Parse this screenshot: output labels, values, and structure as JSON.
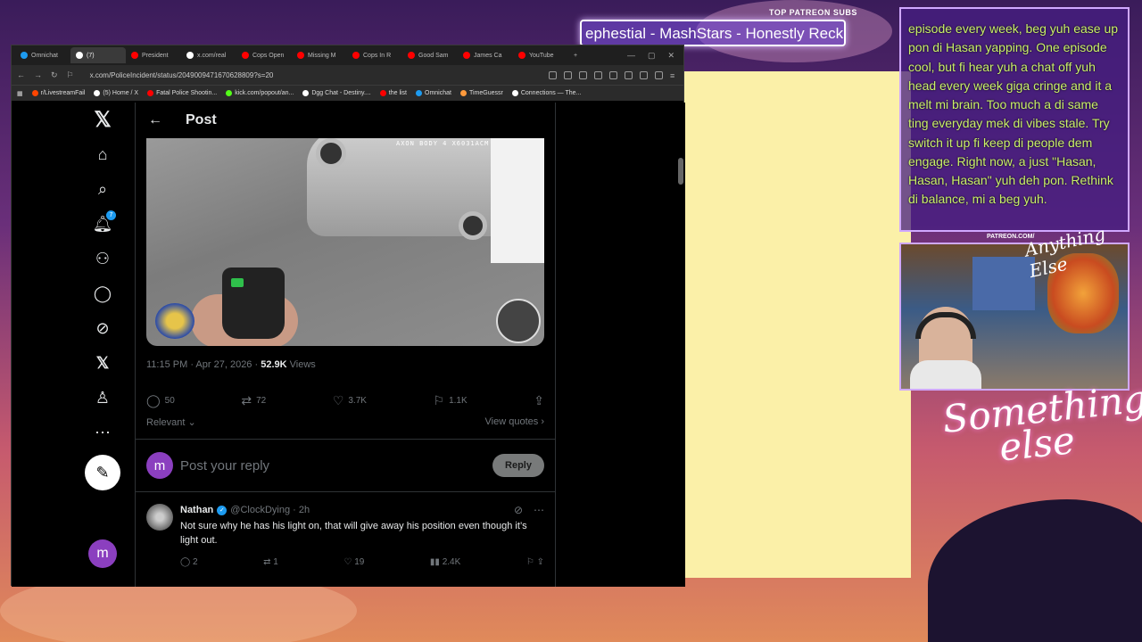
{
  "browser": {
    "tabs": [
      {
        "label": "Omnichat",
        "color": "#1d9bf0",
        "active": false
      },
      {
        "label": "(7)",
        "color": "#ffffff",
        "active": true
      },
      {
        "label": "President",
        "color": "#ff0000",
        "active": false
      },
      {
        "label": "x.com/real",
        "color": "#ffffff",
        "active": false
      },
      {
        "label": "Cops Open",
        "color": "#ff0000",
        "active": false
      },
      {
        "label": "Missing M",
        "color": "#ff0000",
        "active": false
      },
      {
        "label": "Cops In R",
        "color": "#ff0000",
        "active": false
      },
      {
        "label": "Good Sam",
        "color": "#ff0000",
        "active": false
      },
      {
        "label": "James Ca",
        "color": "#ff0000",
        "active": false
      },
      {
        "label": "YouTube",
        "color": "#ff0000",
        "active": false
      }
    ],
    "new_tab": "+",
    "url": "x.com/PoliceIncident/status/2049009471670628809?s=20",
    "bookmarks": [
      {
        "label": "r/LivestreamFail",
        "color": "#ff4500"
      },
      {
        "label": "(5) Home / X",
        "color": "#ffffff"
      },
      {
        "label": "Fatal Police Shootin...",
        "color": "#ff0000"
      },
      {
        "label": "kick.com/popout/an...",
        "color": "#53fc18"
      },
      {
        "label": "Dgg Chat - Destiny....",
        "color": "#ffffff"
      },
      {
        "label": "the list",
        "color": "#ff0000"
      },
      {
        "label": "Omnichat",
        "color": "#1d9bf0"
      },
      {
        "label": "TimeGuessr",
        "color": "#ff9a3c"
      },
      {
        "label": "Connections — The...",
        "color": "#ffffff"
      }
    ]
  },
  "x": {
    "nav": {
      "notifications_badge": "7",
      "avatar_letter": "m"
    },
    "header": {
      "back": "←",
      "title": "Post"
    },
    "video": {
      "stamp": "AXON BODY 4 X6031ACM"
    },
    "meta": {
      "time": "11:15 PM · Apr 27, 2026 · ",
      "views_count": "52.9K",
      "views_label": " Views"
    },
    "actions": {
      "replies": "50",
      "reposts": "72",
      "likes": "3.7K",
      "bookmarks": "1.1K"
    },
    "sort": {
      "label": "Relevant",
      "quotes": "View quotes"
    },
    "composer": {
      "avatar_letter": "m",
      "placeholder": "Post your reply",
      "button": "Reply"
    },
    "reply": {
      "name": "Nathan",
      "handle": "@ClockDying · 2h",
      "text": "Not sure why he has his light on, that will give away his position even though it’s light out.",
      "replies": "2",
      "reposts": "1",
      "likes": "19",
      "views": "2.4K"
    }
  },
  "stream": {
    "top_subs_label": "TOP PATREON SUBS",
    "ticker": "ephestial - MashStars - Honestly Reck",
    "chat_text": "episode every week, beg yuh ease up pon di Hasan yapping. One episode cool, but fi hear yuh a chat off yuh head every week giga cringe and it a melt mi brain. Too much a di same ting everyday mek di vibes stale. Try switch it up fi keep di people dem engage. Right now, a just \"Hasan, Hasan, Hasan\" yuh deh pon. Rethink di balance, mi a beg yuh.",
    "patreon_label": "PATREON.COM/",
    "patreon_signature": "Anything Else",
    "logo_line1": "Something",
    "logo_line2": "else"
  }
}
